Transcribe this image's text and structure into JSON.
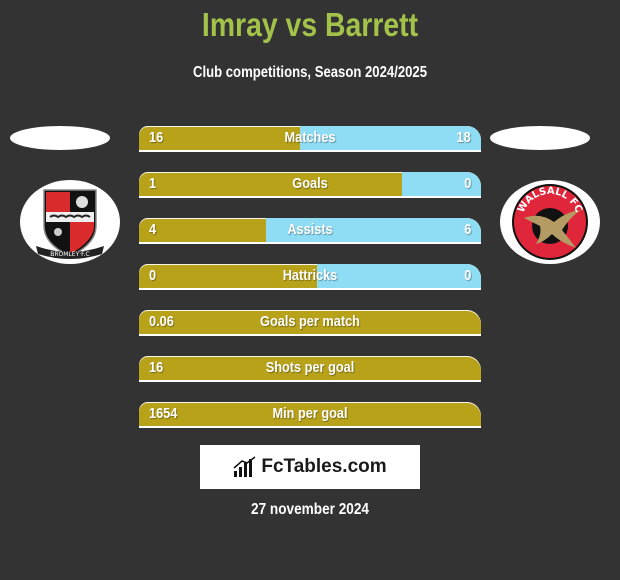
{
  "header": {
    "title": "Imray vs Barrett",
    "subtitle": "Club competitions, Season 2024/2025"
  },
  "teams": {
    "left": {
      "name": "Bromley FC",
      "badge_text": "BROMLEY·F.C",
      "icon": "bromley-fc-crest"
    },
    "right": {
      "name": "Walsall FC",
      "badge_text": "WALSALL FC",
      "icon": "walsall-fc-crest"
    }
  },
  "colors": {
    "title": "#a3c24a",
    "left_bar": "#b8a21a",
    "right_bar": "#8fdcf5",
    "background": "#333333"
  },
  "stats": [
    {
      "label": "Matches",
      "left": "16",
      "right": "18",
      "left_share": 0.47
    },
    {
      "label": "Goals",
      "left": "1",
      "right": "0",
      "left_share": 0.77
    },
    {
      "label": "Assists",
      "left": "4",
      "right": "6",
      "left_share": 0.37
    },
    {
      "label": "Hattricks",
      "left": "0",
      "right": "0",
      "left_share": 0.52
    },
    {
      "label": "Goals per match",
      "left": "0.06",
      "right": "",
      "left_share": 1
    },
    {
      "label": "Shots per goal",
      "left": "16",
      "right": "",
      "left_share": 1
    },
    {
      "label": "Min per goal",
      "left": "1654",
      "right": "",
      "left_share": 1
    }
  ],
  "footer": {
    "brand": "FcTables.com",
    "brand_icon": "bar-chart-icon",
    "date": "27 november 2024"
  }
}
